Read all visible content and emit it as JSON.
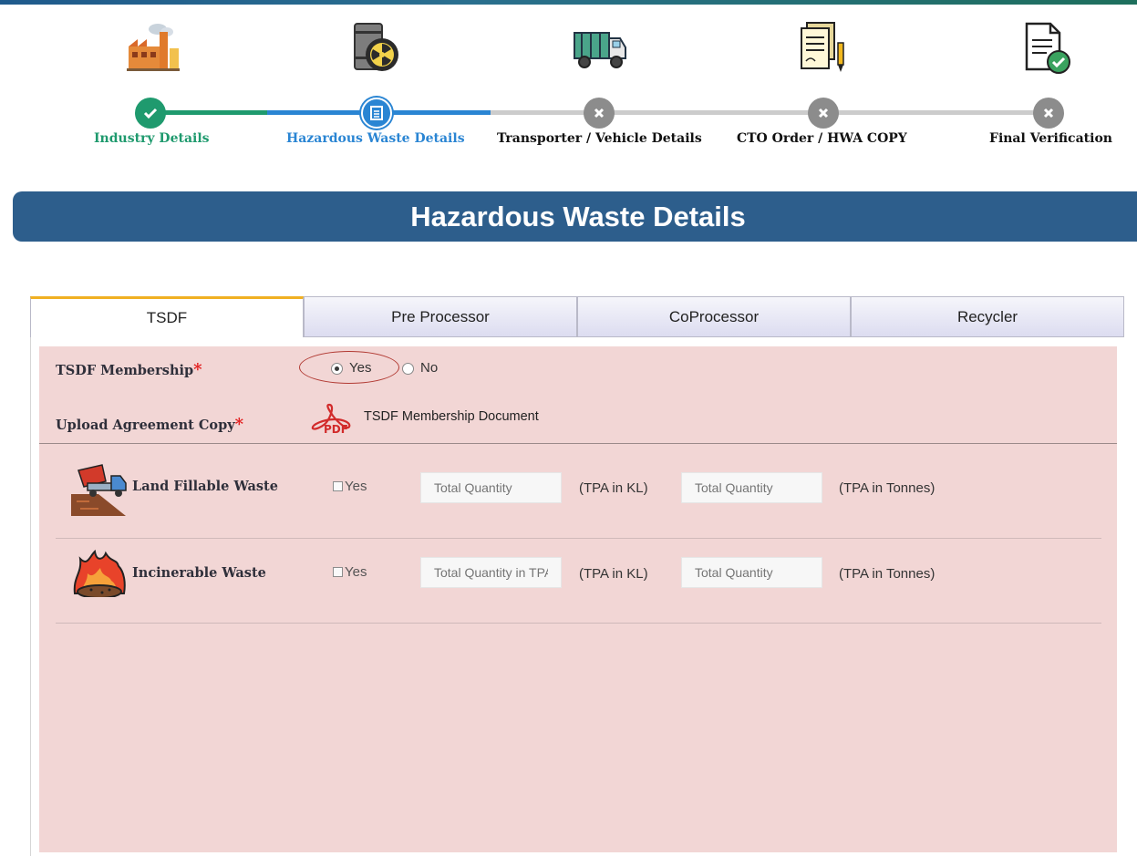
{
  "stepper": {
    "steps": [
      {
        "label": "Industry Details",
        "icon": "factory-icon",
        "state": "done"
      },
      {
        "label": "Hazardous Waste Details",
        "icon": "waste-barrel-icon",
        "state": "active"
      },
      {
        "label": "Transporter / Vehicle Details",
        "icon": "truck-icon",
        "state": "pending"
      },
      {
        "label": "CTO Order / HWA COPY",
        "icon": "documents-pen-icon",
        "state": "pending"
      },
      {
        "label": "Final Verification",
        "icon": "verified-document-icon",
        "state": "pending"
      }
    ]
  },
  "page": {
    "title": "Hazardous Waste Details"
  },
  "tabs": [
    {
      "label": "TSDF",
      "active": true
    },
    {
      "label": "Pre Processor",
      "active": false
    },
    {
      "label": "CoProcessor",
      "active": false
    },
    {
      "label": "Recycler",
      "active": false
    }
  ],
  "form": {
    "membership": {
      "label": "TSDF Membership",
      "required_mark": "*",
      "yes_label": "Yes",
      "no_label": "No",
      "selected": "Yes"
    },
    "agreement": {
      "label": "Upload Agreement Copy",
      "required_mark": "*",
      "document_label": "TSDF Membership Document",
      "pdf_icon_text": "PDF"
    },
    "waste_rows": [
      {
        "label": "Land Fillable Waste",
        "icon": "dump-truck-icon",
        "checkbox_label": "Yes",
        "checked": false,
        "kl_placeholder": "Total Quantity",
        "kl_unit": "(TPA in KL)",
        "tonnes_placeholder": "Total Quantity",
        "tonnes_unit": "(TPA in Tonnes)"
      },
      {
        "label": "Incinerable Waste",
        "icon": "fire-waste-icon",
        "checkbox_label": "Yes",
        "checked": false,
        "kl_placeholder": "Total Quantity in TPA",
        "kl_unit": "(TPA in KL)",
        "tonnes_placeholder": "Total Quantity",
        "tonnes_unit": "(TPA in Tonnes)"
      }
    ]
  },
  "colors": {
    "done": "#1f9a6e",
    "active": "#2a85d3",
    "pending": "#8c8c8c",
    "banner": "#2d5e8c",
    "panel": "#f2d6d5",
    "required": "#e32020"
  }
}
